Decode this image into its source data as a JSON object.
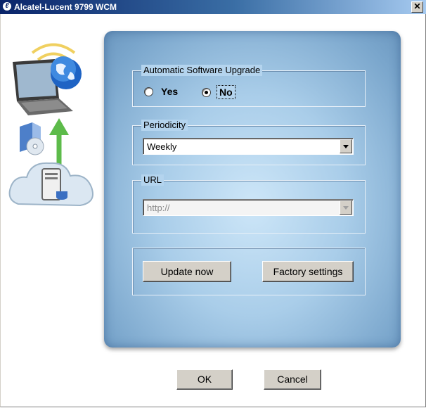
{
  "window": {
    "title": "Alcatel-Lucent 9799 WCM",
    "close_glyph": "✕",
    "title_icon": "alcatel-lucent-logo-icon"
  },
  "auto_upgrade": {
    "legend": "Automatic Software Upgrade",
    "options": [
      {
        "label": "Yes",
        "checked": false
      },
      {
        "label": "No",
        "checked": true
      }
    ]
  },
  "periodicity": {
    "legend": "Periodicity",
    "value": "Weekly"
  },
  "url": {
    "legend": "URL",
    "value": "http://",
    "disabled": true
  },
  "actions": {
    "update_now": "Update now",
    "factory_settings": "Factory settings"
  },
  "footer": {
    "ok": "OK",
    "cancel": "Cancel"
  },
  "colors": {
    "titlebar_start": "#0a246a",
    "titlebar_end": "#a6caf0",
    "panel": "#a9cde9",
    "button_face": "#d4d0c8"
  },
  "illustration": {
    "icons": [
      "laptop-icon",
      "globe-icon",
      "software-box-icon",
      "upload-arrow-icon",
      "cloud-server-icon"
    ]
  }
}
